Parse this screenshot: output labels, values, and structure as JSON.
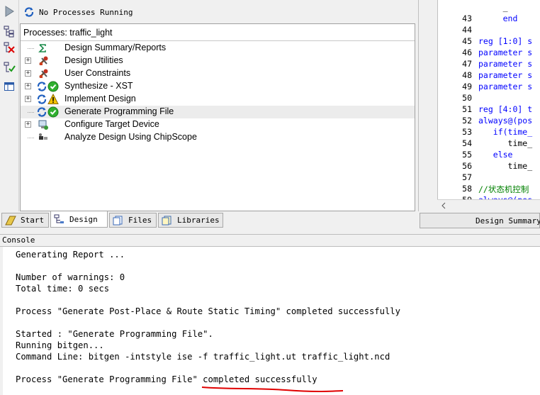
{
  "design_panel": {
    "status": "No Processes Running",
    "processes_header": "Processes: traffic_light",
    "processes": [
      {
        "label": "Design Summary/Reports",
        "expandable": false,
        "icon": "sigma-icon"
      },
      {
        "label": "Design Utilities",
        "expandable": true,
        "icon": "tools-icon"
      },
      {
        "label": "User Constraints",
        "expandable": true,
        "icon": "tools-icon"
      },
      {
        "label": "Synthesize - XST",
        "expandable": true,
        "icon": "check-icon"
      },
      {
        "label": "Implement Design",
        "expandable": true,
        "icon": "warning-icon"
      },
      {
        "label": "Generate Programming File",
        "expandable": false,
        "icon": "check-icon",
        "selected": true
      },
      {
        "label": "Configure Target Device",
        "expandable": true,
        "icon": "device-icon"
      },
      {
        "label": "Analyze Design Using ChipScope",
        "expandable": false,
        "icon": "chipscope-icon"
      }
    ],
    "tabs": [
      {
        "label": "Start"
      },
      {
        "label": "Design",
        "active": true
      },
      {
        "label": "Files"
      },
      {
        "label": "Libraries"
      }
    ]
  },
  "editor": {
    "lines": [
      {
        "num": "",
        "code": "     _"
      },
      {
        "num": "43",
        "code": "     end"
      },
      {
        "num": "44",
        "code": ""
      },
      {
        "num": "45",
        "code": "reg [1:0] s"
      },
      {
        "num": "46",
        "code": "parameter s"
      },
      {
        "num": "47",
        "code": "parameter s"
      },
      {
        "num": "48",
        "code": "parameter s"
      },
      {
        "num": "49",
        "code": "parameter s"
      },
      {
        "num": "50",
        "code": ""
      },
      {
        "num": "51",
        "code": "reg [4:0] t"
      },
      {
        "num": "52",
        "code": "always@(pos"
      },
      {
        "num": "53",
        "code": "   if(time_"
      },
      {
        "num": "54",
        "code": "      time_"
      },
      {
        "num": "55",
        "code": "   else"
      },
      {
        "num": "56",
        "code": "      time_"
      },
      {
        "num": "57",
        "code": ""
      },
      {
        "num": "58",
        "code": "//状态机控制"
      },
      {
        "num": "59",
        "code": "always@(pos"
      }
    ],
    "design_summary_tab": "Design Summary"
  },
  "console": {
    "title": "Console",
    "lines": [
      "Generating Report ...",
      "",
      "Number of warnings: 0",
      "Total time: 0 secs",
      "",
      "Process \"Generate Post-Place & Route Static Timing\" completed successfully",
      "",
      "Started : \"Generate Programming File\".",
      "Running bitgen...",
      "Command Line: bitgen -intstyle ise -f traffic_light.ut traffic_light.ncd",
      "",
      "Process \"Generate Programming File\" completed successfully"
    ]
  },
  "colors": {
    "keyword": "#0000ff",
    "comment": "#008000",
    "annotation_underline": "#e00000",
    "check": "#2fb02f",
    "warning": "#f2c200"
  }
}
